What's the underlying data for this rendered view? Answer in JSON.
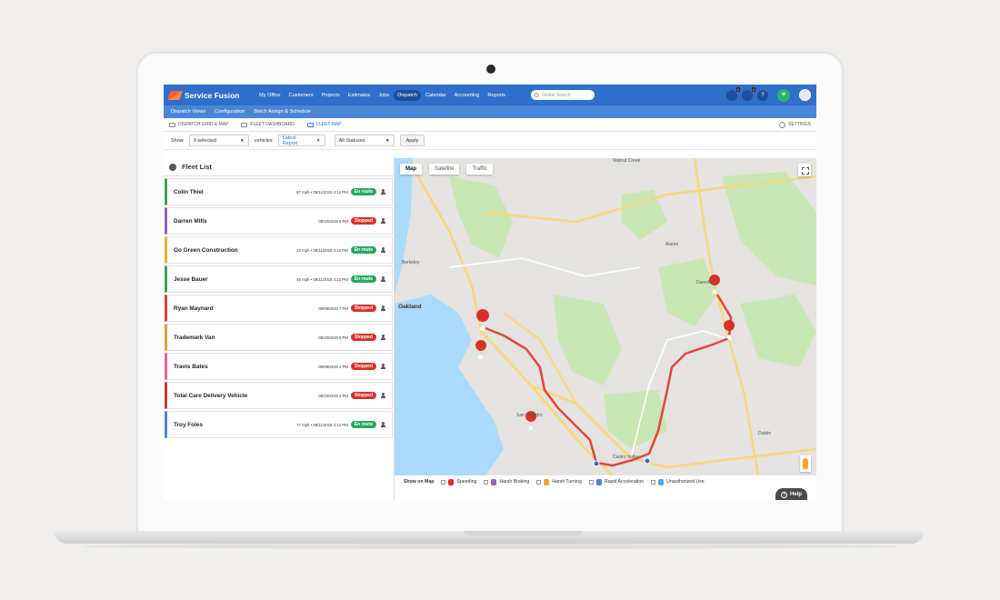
{
  "app": {
    "name": "Service Fusion"
  },
  "nav": {
    "items": [
      "My Office",
      "Customers",
      "Projects",
      "Estimates",
      "Jobs",
      "Dispatch",
      "Calendar",
      "Accounting",
      "Reports"
    ],
    "search_placeholder": "Global Search",
    "badges": {
      "chat": "0",
      "tasks": "0"
    },
    "help_glyph": "?",
    "add_glyph": "+"
  },
  "subnav": {
    "items": [
      "Dispatch Views",
      "Configuration",
      "Batch Assign & Schedule"
    ]
  },
  "tabs": {
    "grid": "DISPATCH GRID & MAP",
    "dashboard": "FLEET DASHBOARD",
    "map": "FLEET MAP",
    "settings": "SETTINGS"
  },
  "filters": {
    "show_label": "Show",
    "vehicles_value": "9 selected",
    "vehicles_label": "vehicles",
    "report_value": "Latest Report",
    "status_value": "All Statuses",
    "apply_label": "Apply"
  },
  "fleet": {
    "title": "Fleet List",
    "items": [
      {
        "name": "Colin Thiel",
        "info": "67 mph • 08/11/2019 4:14 PM",
        "status": "En route",
        "kind": "go",
        "color": "#3aa35c"
      },
      {
        "name": "Darren Mills",
        "info": "08/10/2019 8 PM",
        "status": "Stopped",
        "kind": "stop",
        "color": "#8e62c4"
      },
      {
        "name": "Go Green Construction",
        "info": "23 mph • 08/11/2019 4:13 PM",
        "status": "En route",
        "kind": "go",
        "color": "#e2b23a"
      },
      {
        "name": "Jesse Bauer",
        "info": "45 mph • 08/11/2019 4:13 PM",
        "status": "En route",
        "kind": "go",
        "color": "#3aa35c"
      },
      {
        "name": "Ryan Maynard",
        "info": "08/09/2019 7 PM",
        "status": "Stopped",
        "kind": "stop",
        "color": "#d8473c"
      },
      {
        "name": "Trademark Van",
        "info": "08/10/2019 6 PM",
        "status": "Stopped",
        "kind": "stop",
        "color": "#e0a13a"
      },
      {
        "name": "Travis Bates",
        "info": "08/09/2019 4 PM",
        "status": "Stopped",
        "kind": "stop",
        "color": "#e85d9a"
      },
      {
        "name": "Total Care Delivery Vehicle",
        "info": "08/10/2019 4 PM",
        "status": "Stopped",
        "kind": "stop",
        "color": "#c43a3a"
      },
      {
        "name": "Troy Foles",
        "info": "77 mph • 08/11/2019 4:14 PM",
        "status": "En route",
        "kind": "go",
        "color": "#4a86d8"
      }
    ]
  },
  "map": {
    "tabs": [
      "Map",
      "Satellite",
      "Traffic"
    ],
    "labels": {
      "berkeley": "Berkeley",
      "oakland": "Oakland",
      "san_leandro": "San Leandro",
      "danville": "Danville",
      "walnut_creek": "Walnut Creek",
      "alamo": "Alamo",
      "castro_valley": "Castro Valley",
      "dublin": "Dublin"
    }
  },
  "legend": {
    "title": "Show on Map",
    "items": [
      {
        "label": "Speeding",
        "color": "#d8312b"
      },
      {
        "label": "Harsh Braking",
        "color": "#8e62c4"
      },
      {
        "label": "Harsh Turning",
        "color": "#f0a630"
      },
      {
        "label": "Rapid Acceleration",
        "color": "#4a86d8"
      },
      {
        "label": "Unauthorized Use",
        "color": "#5aa7e0"
      }
    ]
  },
  "help": {
    "label": "Help",
    "glyph": "?"
  }
}
